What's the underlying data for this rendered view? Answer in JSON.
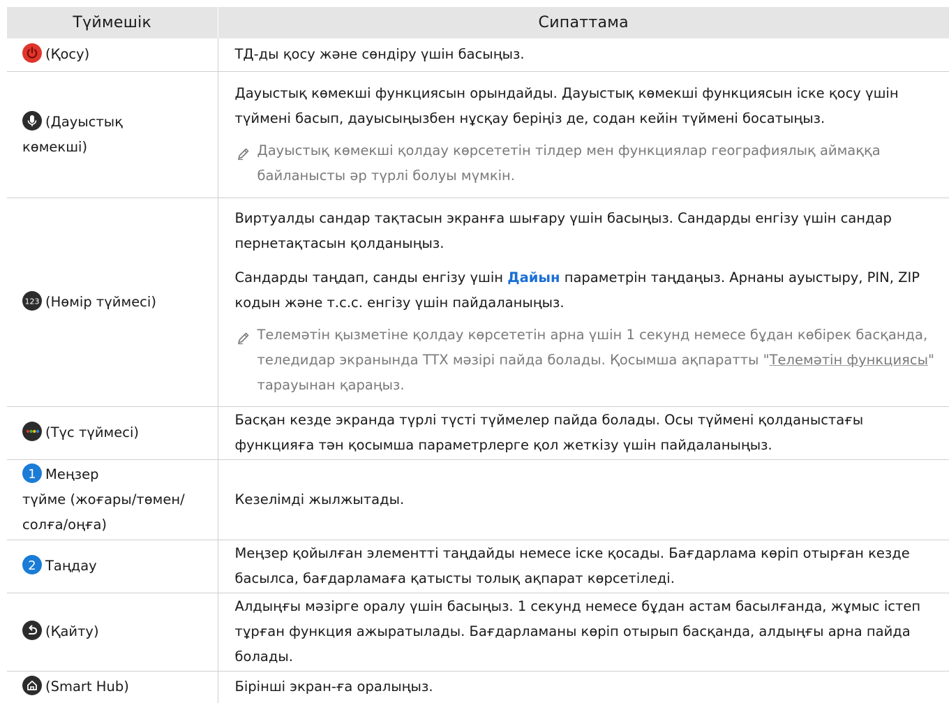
{
  "header": {
    "col_button": "Түймешік",
    "col_desc": "Сипаттама"
  },
  "rows": [
    {
      "key": "(Қосу)",
      "icon": "power-icon",
      "desc": [
        "ТД-ды қосу және сөндіру үшін басыңыз."
      ]
    },
    {
      "key_lines": [
        "(Дауыстық",
        "көмекші)"
      ],
      "icon": "microphone-icon",
      "desc": [
        "Дауыстық көмекші функциясын орындайды. Дауыстық көмекші функциясын іске қосу үшін түймені басып, дауысыңызбен нұсқау беріңіз де, содан кейін түймені босатыңыз."
      ],
      "note": "Дауыстық көмекші қолдау көрсететін тілдер мен функциялар географиялық аймаққа байланысты әр түрлі болуы мүмкін."
    },
    {
      "key": "(Нөмір түймесі)",
      "icon": "number-123-icon",
      "icon_text": "123",
      "desc": [
        "Виртуалды сандар тақтасын экранға шығару үшін басыңыз. Сандарды енгізу үшін сандар пернетақтасын қолданыңыз."
      ],
      "desc2_pre": "Сандарды таңдап, санды енгізу үшін ",
      "desc2_link": "Дайын",
      "desc2_post": " параметрін таңдаңыз. Арнаны ауыстыру, PIN, ZIP кодын және т.с.с. енгізу үшін пайдаланыңыз.",
      "note_pre": "Телемәтін қызметіне қолдау көрсететін арна үшін 1 секунд немесе бұдан көбірек басқанда, теледидар экранында TTX мәзірі пайда болады. Қосымша ақпаратты \"",
      "note_link": "Телемәтін функциясы",
      "note_post": "\" тарауынан қараңыз."
    },
    {
      "key": "(Түс түймесі)",
      "icon": "color-buttons-icon",
      "desc": [
        "Басқан кезде экранда түрлі түсті түймелер пайда болады. Осы түймені қолданыстағы функцияға тән қосымша параметрлерге қол жеткізу үшін пайдаланыңыз."
      ]
    },
    {
      "key_lines": [
        "Меңзер",
        "түйме (жоғары/төмен/",
        "солға/оңға)"
      ],
      "icon": "number-1-icon",
      "icon_text": "1",
      "desc": [
        "Кезелімді жылжытады."
      ]
    },
    {
      "key": "Таңдау",
      "icon": "number-2-icon",
      "icon_text": "2",
      "desc": [
        "Меңзер қойылған элементті таңдайды немесе іске қосады. Бағдарлама көріп отырған кезде басылса, бағдарламаға қатысты толық ақпарат көрсетіледі."
      ]
    },
    {
      "key": "(Қайту)",
      "icon": "return-arrow-icon",
      "desc": [
        "Алдыңғы мәзірге оралу үшін басыңыз. 1 секунд немесе бұдан астам басылғанда, жұмыс істеп тұрған функция ажыратылады. Бағдарламаны көріп отырып басқанда, алдыңғы арна пайда болады."
      ]
    },
    {
      "key": "(Smart Hub)",
      "icon": "home-icon",
      "desc": [
        "Бірінші экран-ға оралыңыз."
      ]
    }
  ],
  "colors": {
    "header_bg": "#e5e5e5",
    "power_red": "#e0352b",
    "icon_dark": "#2c2c2c",
    "accent_blue": "#1a7cd6",
    "note_gray": "#7a7a7a"
  }
}
